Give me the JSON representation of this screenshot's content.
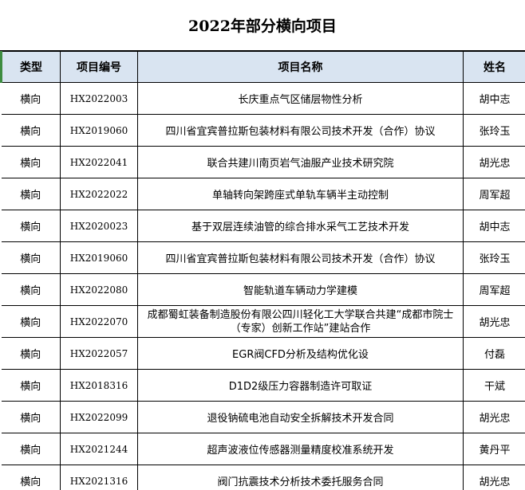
{
  "title": "2022年部分横向项目",
  "headers": {
    "type": "类型",
    "code": "项目编号",
    "name": "项目名称",
    "person": "姓名"
  },
  "rows": [
    {
      "type": "横向",
      "code": "HX2022003",
      "name": "长庆重点气区储层物性分析",
      "person": "胡中志"
    },
    {
      "type": "横向",
      "code": "HX2019060",
      "name": "四川省宜宾普拉斯包装材料有限公司技术开发（合作）协议",
      "person": "张玲玉"
    },
    {
      "type": "横向",
      "code": "HX2022041",
      "name": "联合共建川南页岩气油服产业技术研究院",
      "person": "胡光忠"
    },
    {
      "type": "横向",
      "code": "HX2022022",
      "name": "单轴转向架跨座式单轨车辆半主动控制",
      "person": "周军超"
    },
    {
      "type": "横向",
      "code": "HX2020023",
      "name": "基于双层连续油管的综合排水采气工艺技术开发",
      "person": "胡中志"
    },
    {
      "type": "横向",
      "code": "HX2019060",
      "name": "四川省宜宾普拉斯包装材料有限公司技术开发（合作）协议",
      "person": "张玲玉"
    },
    {
      "type": "横向",
      "code": "HX2022080",
      "name": "智能轨道车辆动力学建模",
      "person": "周军超"
    },
    {
      "type": "横向",
      "code": "HX2022070",
      "name": "成都蜀虹装备制造股份有限公四川轻化工大学联合共建“成都市院士（专家）创新工作站”建站合作",
      "person": "胡光忠"
    },
    {
      "type": "横向",
      "code": "HX2022057",
      "name": "EGR阀CFD分析及结构优化设",
      "person": "付磊"
    },
    {
      "type": "横向",
      "code": "HX2018316",
      "name": "D1D2级压力容器制造许可取证",
      "person": "干斌"
    },
    {
      "type": "横向",
      "code": "HX2022099",
      "name": "退役钠硫电池自动安全拆解技术开发合同",
      "person": "胡光忠"
    },
    {
      "type": "横向",
      "code": "HX2021244",
      "name": "超声波液位传感器测量精度校准系统开发",
      "person": "黄丹平"
    },
    {
      "type": "横向",
      "code": "HX2021316",
      "name": "阀门抗震技术分析技术委托服务合同",
      "person": "胡光忠"
    }
  ]
}
